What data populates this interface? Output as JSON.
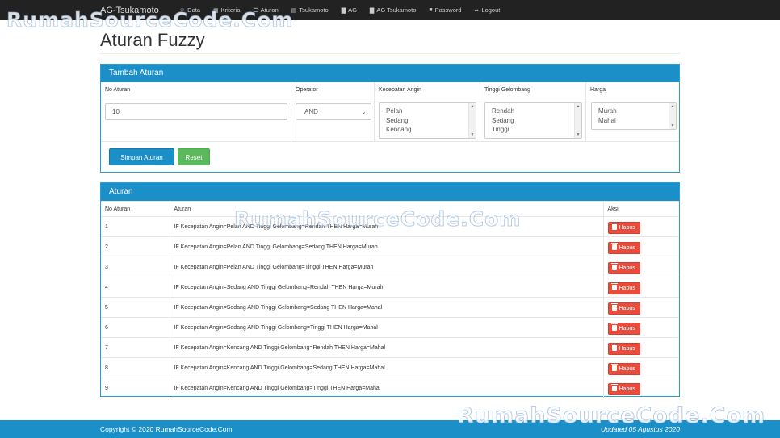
{
  "navbar": {
    "brand": "AG-Tsukamoto",
    "items": [
      {
        "label": "Data",
        "icon": "user-icon",
        "glyph": "☺"
      },
      {
        "label": "Kriteria",
        "icon": "grid-icon",
        "glyph": "▦"
      },
      {
        "label": "Aturan",
        "icon": "list-icon",
        "glyph": "☰"
      },
      {
        "label": "Tsukamoto",
        "icon": "document-icon",
        "glyph": "▤"
      },
      {
        "label": "AG",
        "icon": "chart-icon",
        "glyph": "▇"
      },
      {
        "label": "AG Tsukamoto",
        "icon": "chart-icon",
        "glyph": "▇"
      },
      {
        "label": "Password",
        "icon": "lock-icon",
        "glyph": "■"
      },
      {
        "label": "Logout",
        "icon": "logout-icon",
        "glyph": "➦"
      }
    ]
  },
  "page": {
    "title": "Aturan Fuzzy"
  },
  "form": {
    "heading": "Tambah Aturan",
    "labels": {
      "no": "No Aturan",
      "operator": "Operator",
      "kecepatan": "Kecepatan Angin",
      "tinggi": "Tinggi Gelombang",
      "harga": "Harga"
    },
    "no_value": "10",
    "operator_value": "AND",
    "kecepatan_options": [
      "Pelan",
      "Sedang",
      "Kencang"
    ],
    "tinggi_options": [
      "Rendah",
      "Sedang",
      "Tinggi"
    ],
    "harga_options": [
      "Murah",
      "Mahal"
    ],
    "save_label": "Simpan Aturan",
    "reset_label": "Reset"
  },
  "rules": {
    "heading": "Aturan",
    "columns": [
      "No Aturan",
      "Aturan",
      "Aksi"
    ],
    "delete_label": "Hapus",
    "rows": [
      {
        "no": "1",
        "rule": "IF Kecepatan Angin=Pelan AND Tinggi Gelombang=Rendah THEN Harga=Murah"
      },
      {
        "no": "2",
        "rule": "IF Kecepatan Angin=Pelan AND Tinggi Gelombang=Sedang THEN Harga=Murah"
      },
      {
        "no": "3",
        "rule": "IF Kecepatan Angin=Pelan AND Tinggi Gelombang=Tinggi THEN Harga=Murah"
      },
      {
        "no": "4",
        "rule": "IF Kecepatan Angin=Sedang AND Tinggi Gelombang=Rendah THEN Harga=Murah"
      },
      {
        "no": "5",
        "rule": "IF Kecepatan Angin=Sedang AND Tinggi Gelombang=Sedang THEN Harga=Mahal"
      },
      {
        "no": "6",
        "rule": "IF Kecepatan Angin=Sedang AND Tinggi Gelombang=Tinggi THEN Harga=Mahal"
      },
      {
        "no": "7",
        "rule": "IF Kecepatan Angin=Kencang AND Tinggi Gelombang=Rendah THEN Harga=Mahal"
      },
      {
        "no": "8",
        "rule": "IF Kecepatan Angin=Kencang AND Tinggi Gelombang=Sedang THEN Harga=Mahal"
      },
      {
        "no": "9",
        "rule": "IF Kecepatan Angin=Kencang AND Tinggi Gelombang=Tinggi THEN Harga=Mahal"
      }
    ]
  },
  "footer": {
    "copyright": "Copyright © 2020 RumahSourceCode.Com",
    "updated": "Updated 05 Agustus 2020"
  },
  "watermark": {
    "text": "RumahSourceCode.Com"
  },
  "colors": {
    "primary": "#1b8fc7",
    "success": "#5cb85c",
    "danger": "#e74c3c",
    "navbar": "#222222"
  }
}
